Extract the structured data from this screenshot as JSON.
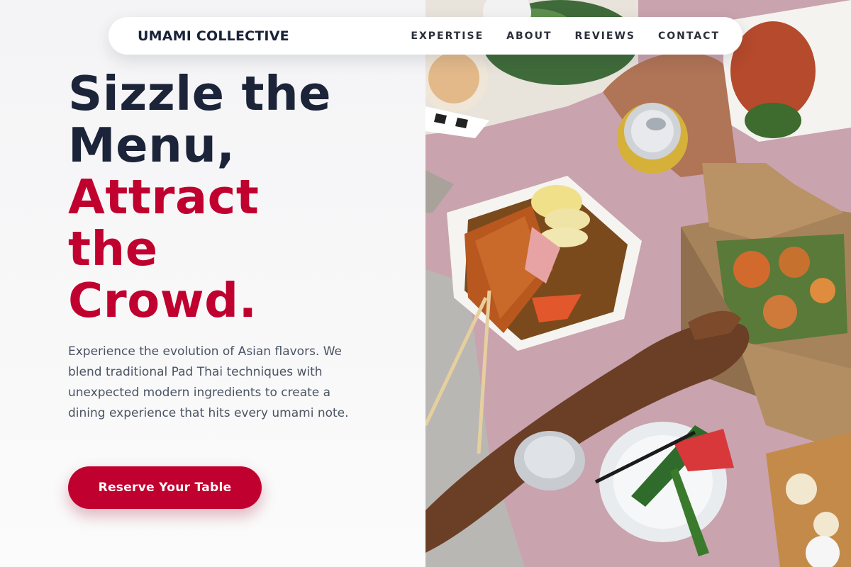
{
  "brand": {
    "name": "UMAMI COLLECTIVE"
  },
  "nav": {
    "links": [
      {
        "label": "EXPERTISE"
      },
      {
        "label": "ABOUT"
      },
      {
        "label": "REVIEWS"
      },
      {
        "label": "CONTACT"
      }
    ]
  },
  "hero": {
    "headline_line1": "Sizzle the",
    "headline_line2": "Menu,",
    "headline_accent1": "Attract",
    "headline_accent2": "the",
    "headline_accent3": "Crowd.",
    "description": "Experience the evolution of Asian flavors. We blend traditional Pad Thai techniques with unexpected modern ingredients to create a dining experience that hits every umami note.",
    "cta_label": "Reserve Your Table"
  },
  "colors": {
    "accent": "#c0002e",
    "heading": "#1b2438",
    "body_text": "#4b5463",
    "table_surface": "#c9a1ad"
  }
}
